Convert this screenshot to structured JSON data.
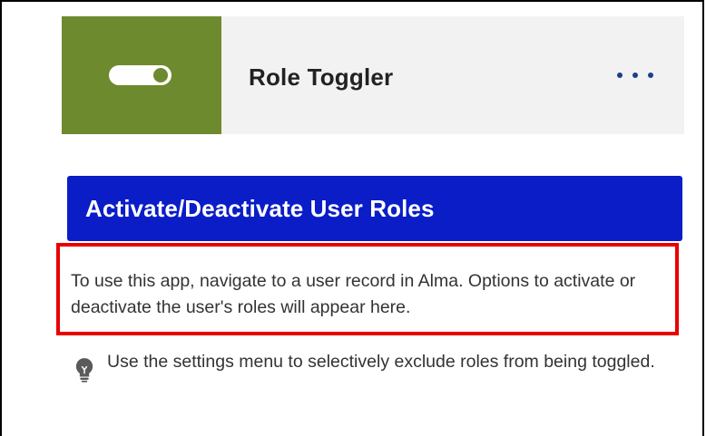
{
  "header": {
    "title": "Role Toggler",
    "toggle_state": "on",
    "menu_icon": "more-horizontal-icon"
  },
  "banner": {
    "title": "Activate/Deactivate User Roles"
  },
  "instructions": {
    "text": "To use this app, navigate to a user record in Alma. Options to activate or deactivate the user's roles will appear here."
  },
  "hint": {
    "icon": "lightbulb-icon",
    "text": "Use the settings menu to selectively exclude roles from being toggled."
  },
  "colors": {
    "toggle_tile": "#6e8a2e",
    "header_background": "#f2f2f2",
    "banner_background": "#0a1dc7",
    "highlight_border": "#e80000",
    "menu_dots": "#1f3c8f"
  }
}
